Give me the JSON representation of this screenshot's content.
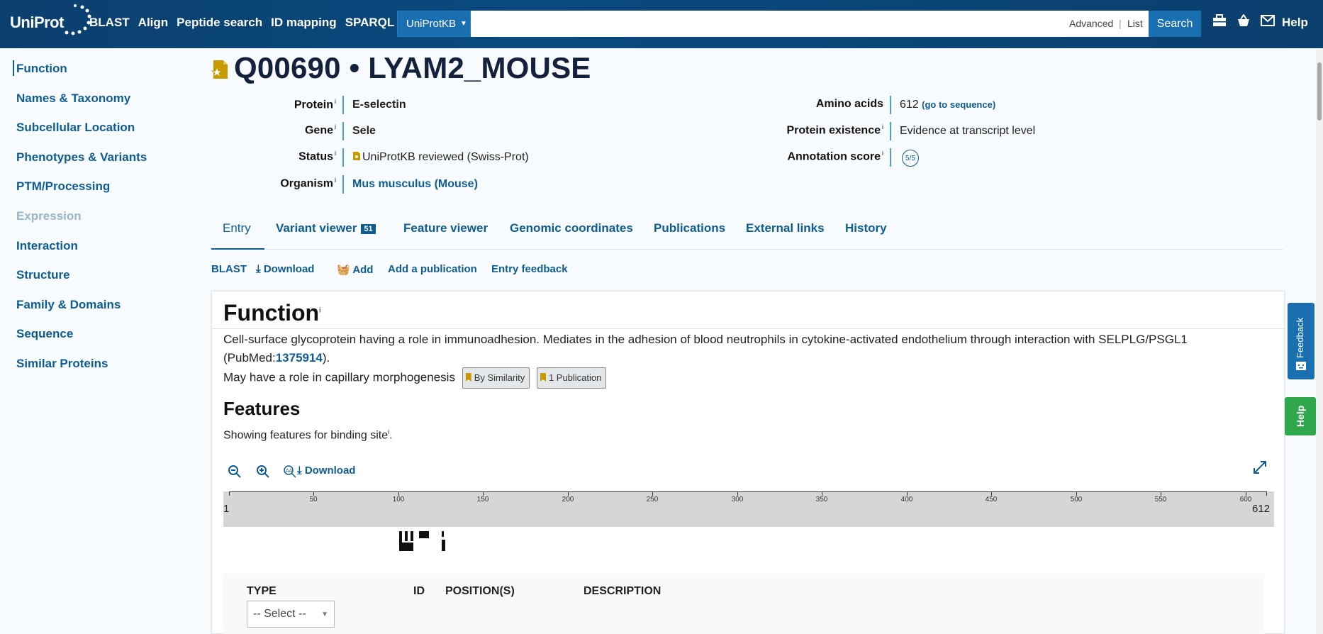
{
  "header": {
    "logo": "UniProt",
    "nav": [
      "BLAST",
      "Align",
      "Peptide search",
      "ID mapping",
      "SPARQL"
    ],
    "database": "UniProtKB",
    "search_value": "",
    "advanced": "Advanced",
    "list": "List",
    "search_button": "Search",
    "help": "Help"
  },
  "sidebar": {
    "items": [
      {
        "label": "Function"
      },
      {
        "label": "Names & Taxonomy"
      },
      {
        "label": "Subcellular Location"
      },
      {
        "label": "Phenotypes & Variants"
      },
      {
        "label": "PTM/Processing"
      },
      {
        "label": "Expression"
      },
      {
        "label": "Interaction"
      },
      {
        "label": "Structure"
      },
      {
        "label": "Family & Domains"
      },
      {
        "label": "Sequence"
      },
      {
        "label": "Similar Proteins"
      }
    ]
  },
  "entry": {
    "title": "Q00690 • LYAM2_MOUSE",
    "protein_label": "Protein",
    "protein": "E-selectin",
    "gene_label": "Gene",
    "gene": "Sele",
    "status_label": "Status",
    "status": "UniProtKB reviewed (Swiss-Prot)",
    "organism_label": "Organism",
    "organism": "Mus musculus (Mouse)",
    "amino_acids_label": "Amino acids",
    "amino_acids": "612",
    "goto_sequence": "(go to sequence)",
    "existence_label": "Protein existence",
    "existence": "Evidence at transcript level",
    "score_label": "Annotation score",
    "score": "5/5",
    "info_marker": "i"
  },
  "tabs": [
    {
      "label": "Entry"
    },
    {
      "label": "Variant viewer",
      "badge": "51"
    },
    {
      "label": "Feature viewer"
    },
    {
      "label": "Genomic coordinates"
    },
    {
      "label": "Publications"
    },
    {
      "label": "External links"
    },
    {
      "label": "History"
    }
  ],
  "actions": {
    "blast": "BLAST",
    "download": "Download",
    "add": "Add",
    "add_publication": "Add a publication",
    "feedback": "Entry feedback"
  },
  "function": {
    "heading": "Function",
    "para1": "Cell-surface glycoprotein having a role in immunoadhesion. Mediates in the adhesion of blood neutrophils in cytokine-activated endothelium through interaction with SELPLG/PSGL1",
    "para1_open": "(PubMed:",
    "pubmed": "1375914",
    "para1_close": ").",
    "para2": "May have a role in capillary morphogenesis",
    "evidence1": "By Similarity",
    "evidence2": "1 Publication",
    "features_heading": "Features",
    "features_note": "Showing features for binding site",
    "features_note_end": ".",
    "download": "Download",
    "ruler_start": "1",
    "ruler_end": "612",
    "ticks": [
      "50",
      "100",
      "150",
      "200",
      "250",
      "300",
      "350",
      "400",
      "450",
      "500",
      "550",
      "600"
    ],
    "table_headers": {
      "type": "TYPE",
      "id": "ID",
      "position": "POSITION(S)",
      "description": "DESCRIPTION"
    },
    "select": "-- Select --"
  },
  "floating": {
    "feedback": "Feedback",
    "help": "Help"
  }
}
